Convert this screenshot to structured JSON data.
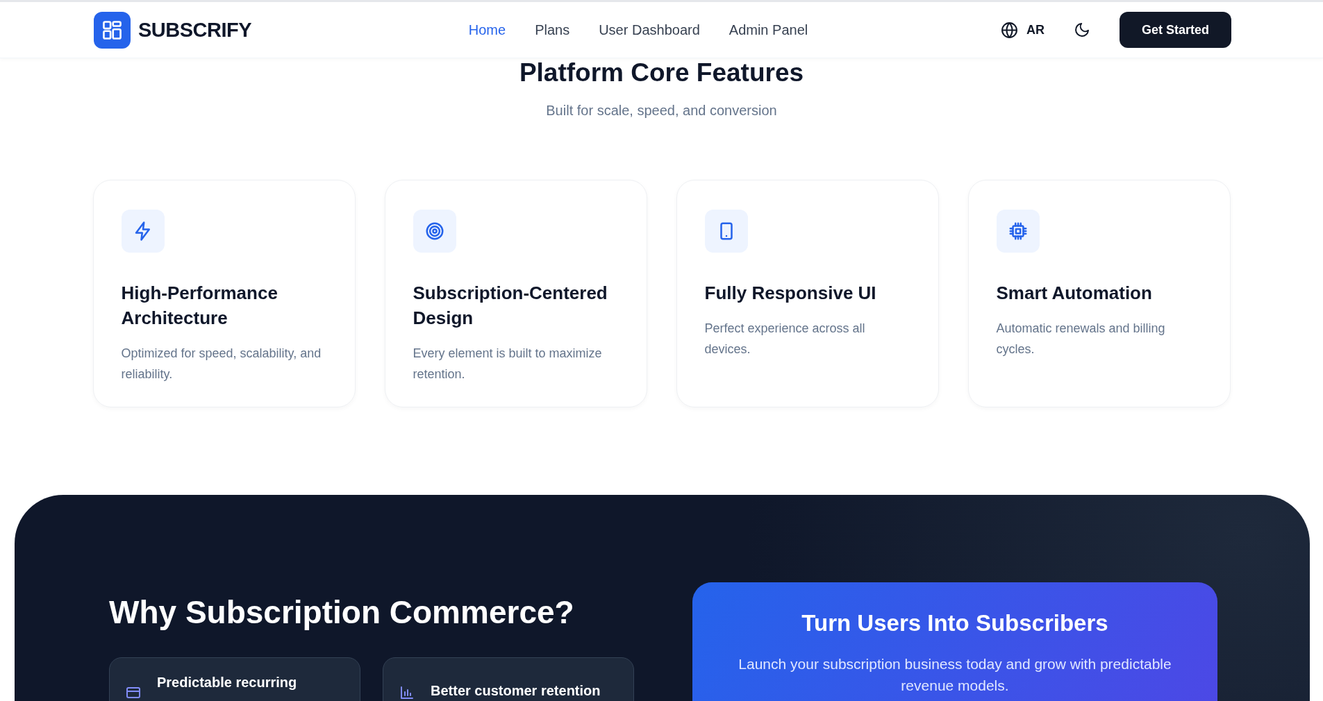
{
  "header": {
    "logo_text": "SUBSCRIFY",
    "nav": [
      {
        "label": "Home",
        "selected": true
      },
      {
        "label": "Plans",
        "selected": false
      },
      {
        "label": "User Dashboard",
        "selected": false
      },
      {
        "label": "Admin Panel",
        "selected": false
      }
    ],
    "language": "AR",
    "cta": "Get Started"
  },
  "features": {
    "title": "Platform Core Features",
    "subtitle": "Built for scale, speed, and conversion",
    "cards": [
      {
        "title": "High-Performance Architecture",
        "text": "Optimized for speed, scalability, and reliability."
      },
      {
        "title": "Subscription-Centered Design",
        "text": "Every element is built to maximize retention."
      },
      {
        "title": "Fully Responsive UI",
        "text": "Perfect experience across all devices."
      },
      {
        "title": "Smart Automation",
        "text": "Automatic renewals and billing cycles."
      }
    ]
  },
  "why": {
    "title": "Why Subscription Commerce?",
    "benefits": [
      {
        "text": "Predictable recurring"
      },
      {
        "text": "Better customer retention"
      }
    ],
    "promo": {
      "title": "Turn Users Into Subscribers",
      "text": "Launch your subscription business today and grow with predictable revenue models."
    }
  }
}
